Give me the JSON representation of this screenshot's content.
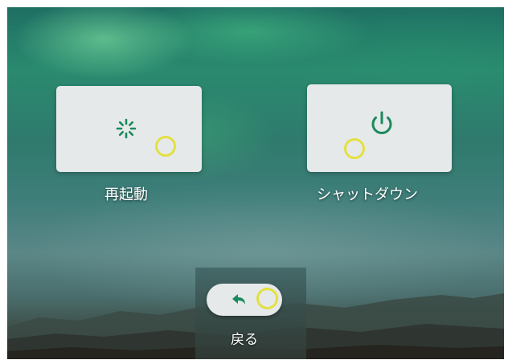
{
  "screen": {
    "title": "power-menu"
  },
  "actions": {
    "restart": {
      "label": "再起動",
      "icon": "restart-spinner-icon"
    },
    "shutdown": {
      "label": "シャットダウン",
      "icon": "power-icon"
    },
    "back": {
      "label": "戻る",
      "icon": "back-arrow-icon"
    }
  },
  "colors": {
    "accent": "#1a8a5c",
    "focus_ring": "#e3e040",
    "tile_background": "#e6e9e9",
    "label_text": "#ffffff"
  }
}
